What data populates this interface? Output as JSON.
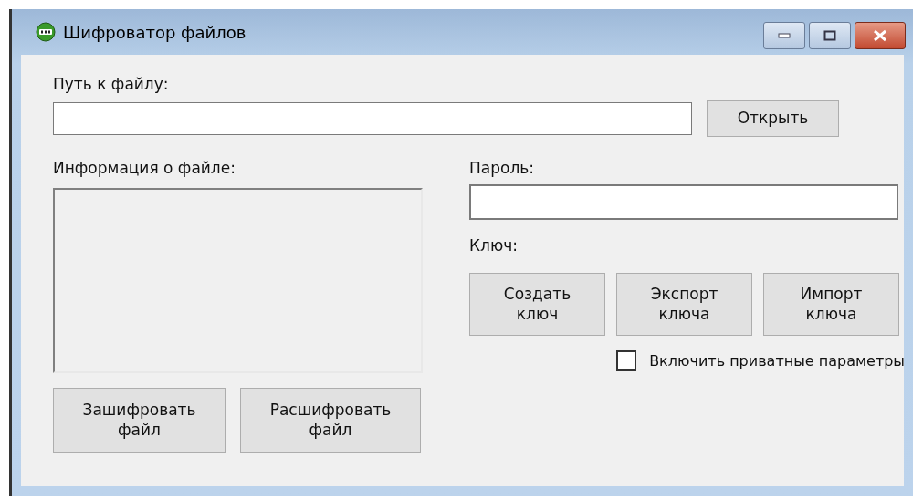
{
  "window": {
    "title": "Шифроватор файлов"
  },
  "path": {
    "label": "Путь к файлу:",
    "open_button": "Открыть"
  },
  "file_info": {
    "label": "Информация о файле:"
  },
  "file_buttons": [
    "Зашифровать\nфайл",
    "Расшифровать\nфайл"
  ],
  "password": {
    "label": "Пароль:"
  },
  "key": {
    "label": "Ключ:",
    "buttons": [
      "Создать\nключ",
      "Экспорт\nключа",
      "Импорт\nключа"
    ]
  },
  "private_params": {
    "label": "Включить приватные параметры",
    "checked": false
  }
}
